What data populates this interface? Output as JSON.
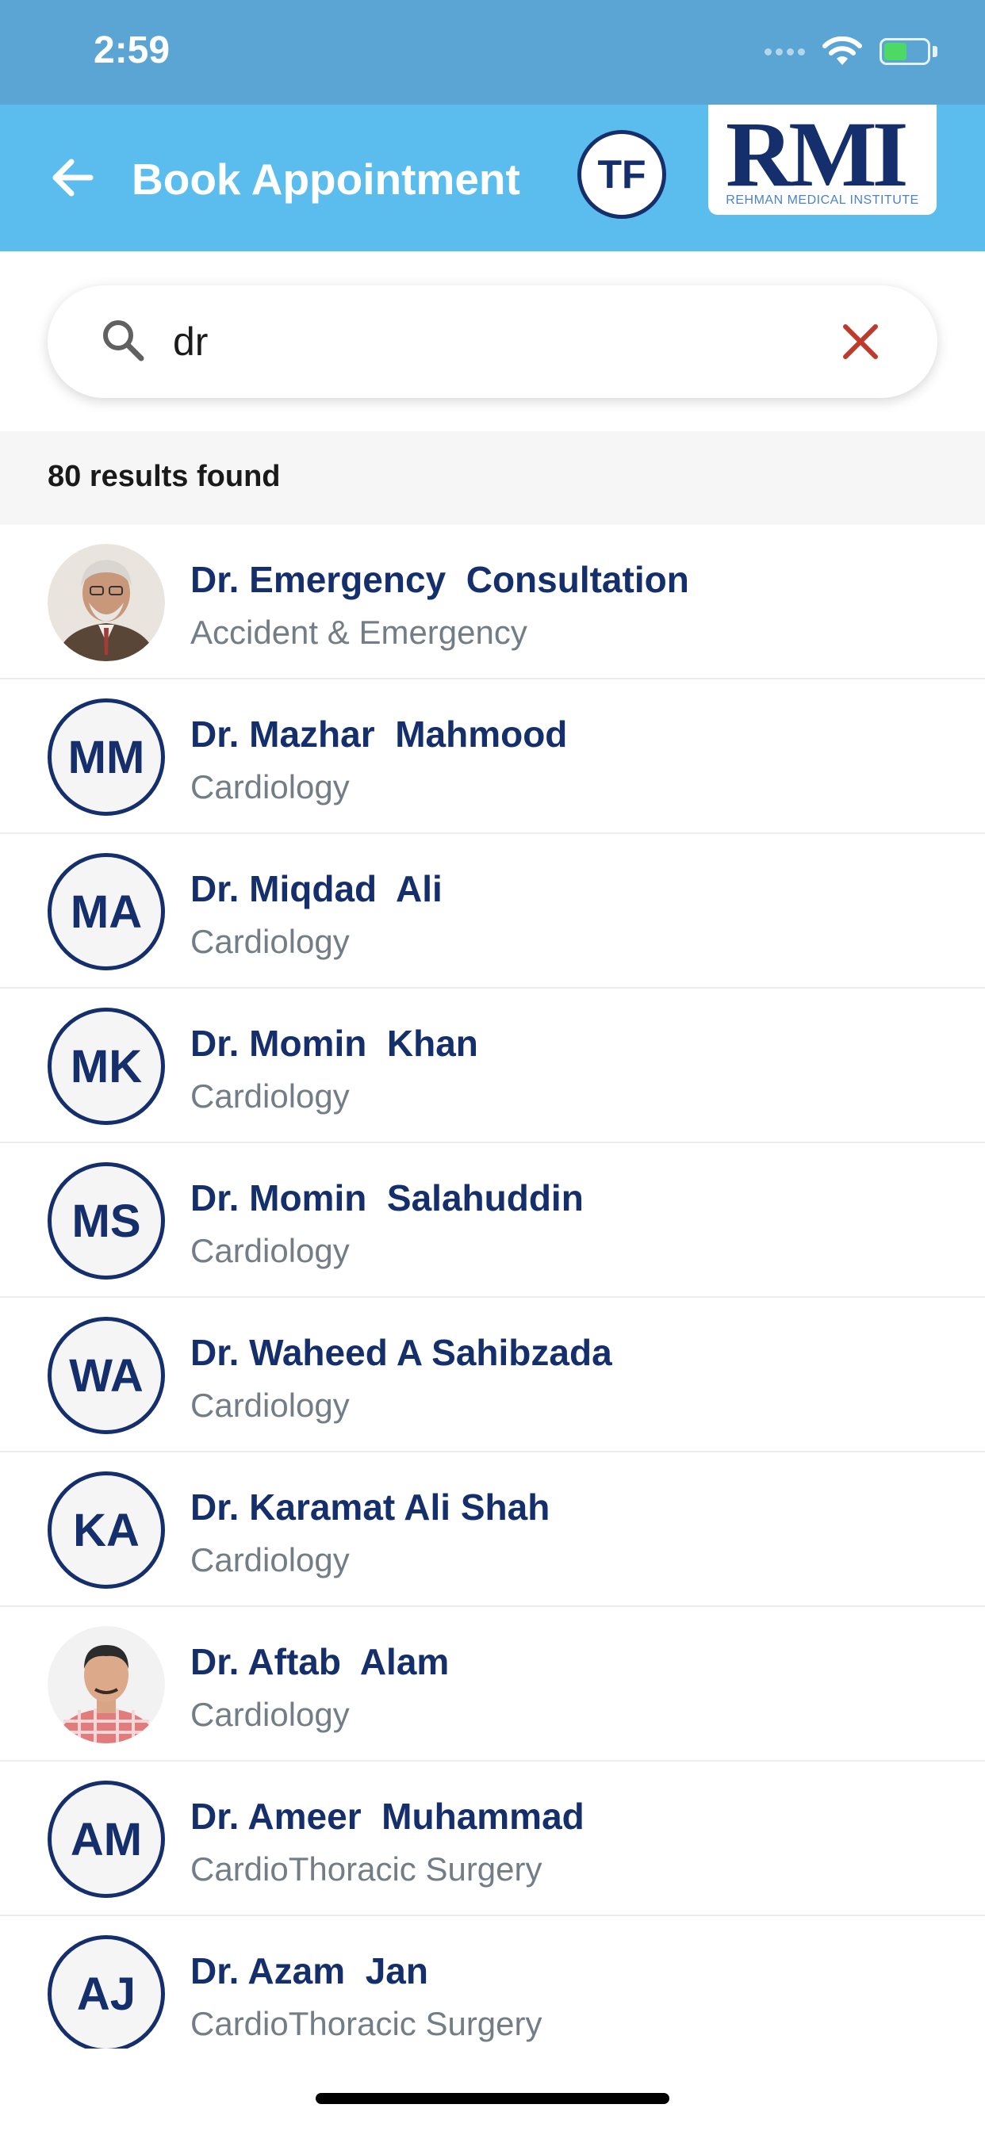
{
  "status_bar": {
    "time": "2:59"
  },
  "header": {
    "title": "Book Appointment",
    "user_initials": "TF",
    "logo_text": "RMI",
    "logo_tagline": "REHMAN MEDICAL INSTITUTE"
  },
  "search": {
    "value": "dr",
    "placeholder": ""
  },
  "results": {
    "count_text": "80 results found"
  },
  "doctors": [
    {
      "name": "Dr. Emergency  Consultation",
      "specialty": "Accident & Emergency",
      "initials": "",
      "photo": true
    },
    {
      "name": "Dr. Mazhar  Mahmood",
      "specialty": "Cardiology",
      "initials": "MM",
      "photo": false
    },
    {
      "name": "Dr. Miqdad  Ali",
      "specialty": "Cardiology",
      "initials": "MA",
      "photo": false
    },
    {
      "name": "Dr. Momin  Khan",
      "specialty": "Cardiology",
      "initials": "MK",
      "photo": false
    },
    {
      "name": "Dr. Momin  Salahuddin",
      "specialty": "Cardiology",
      "initials": "MS",
      "photo": false
    },
    {
      "name": "Dr. Waheed A Sahibzada",
      "specialty": "Cardiology",
      "initials": "WA",
      "photo": false
    },
    {
      "name": "Dr. Karamat Ali Shah",
      "specialty": "Cardiology",
      "initials": "KA",
      "photo": false
    },
    {
      "name": "Dr. Aftab  Alam",
      "specialty": "Cardiology",
      "initials": "",
      "photo": true
    },
    {
      "name": "Dr. Ameer  Muhammad",
      "specialty": "CardioThoracic Surgery",
      "initials": "AM",
      "photo": false
    },
    {
      "name": "Dr. Azam  Jan",
      "specialty": "CardioThoracic Surgery",
      "initials": "AJ",
      "photo": false
    }
  ],
  "colors": {
    "header": "#5bbdee",
    "status_bar": "#5aa5d3",
    "navy": "#142f6b",
    "clear_red": "#c0392b",
    "muted_text": "#737d86"
  }
}
